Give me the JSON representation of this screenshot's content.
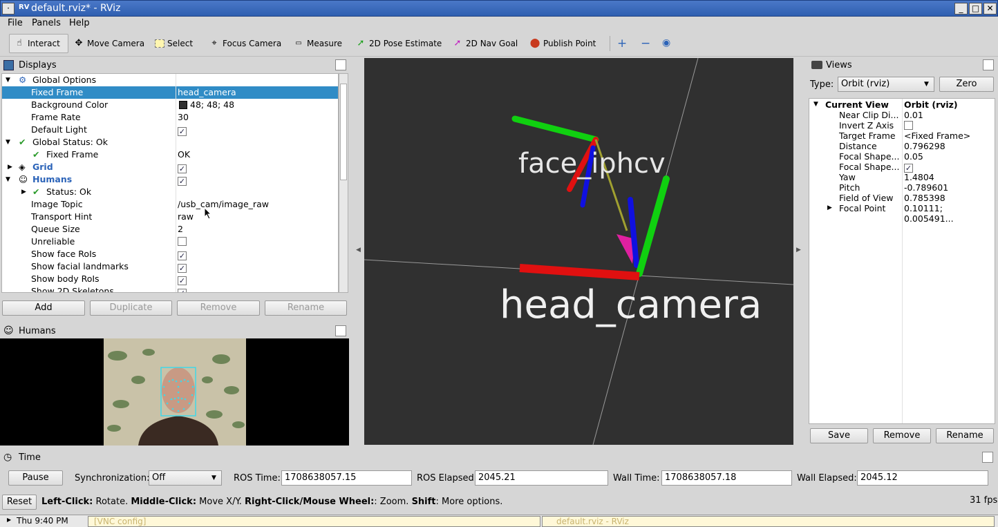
{
  "window": {
    "title": "default.rviz* - RViz",
    "app_icon": "rviz-icon"
  },
  "menu": [
    "File",
    "Panels",
    "Help"
  ],
  "toolbar": {
    "tools": [
      {
        "label": "Interact",
        "icon": "hand-icon",
        "active": true
      },
      {
        "label": "Move Camera",
        "icon": "move-icon"
      },
      {
        "label": "Select",
        "icon": "select-icon"
      },
      {
        "label": "Focus Camera",
        "icon": "crosshair-icon"
      },
      {
        "label": "Measure",
        "icon": "ruler-icon"
      },
      {
        "label": "2D Pose Estimate",
        "icon": "green-arrow-icon"
      },
      {
        "label": "2D Nav Goal",
        "icon": "magenta-arrow-icon"
      },
      {
        "label": "Publish Point",
        "icon": "pin-icon"
      }
    ]
  },
  "displays": {
    "title": "Displays",
    "rows": [
      {
        "key": "Global Options",
        "value": ""
      },
      {
        "key": "Fixed Frame",
        "value": "head_camera"
      },
      {
        "key": "Background Color",
        "value": "48; 48; 48"
      },
      {
        "key": "Frame Rate",
        "value": "30"
      },
      {
        "key": "Default Light",
        "value": ""
      },
      {
        "key": "Global Status: Ok",
        "value": ""
      },
      {
        "key": "Fixed Frame",
        "value": "OK"
      },
      {
        "key": "Grid",
        "value": ""
      },
      {
        "key": "Humans",
        "value": ""
      },
      {
        "key": "Status: Ok",
        "value": ""
      },
      {
        "key": "Image Topic",
        "value": "/usb_cam/image_raw"
      },
      {
        "key": "Transport Hint",
        "value": "raw"
      },
      {
        "key": "Queue Size",
        "value": "2"
      },
      {
        "key": "Unreliable",
        "value": ""
      },
      {
        "key": "Show face RoIs",
        "value": ""
      },
      {
        "key": "Show facial landmarks",
        "value": ""
      },
      {
        "key": "Show body RoIs",
        "value": ""
      },
      {
        "key": "Show 2D Skeletons",
        "value": ""
      }
    ],
    "buttons": {
      "add": "Add",
      "duplicate": "Duplicate",
      "remove": "Remove",
      "rename": "Rename"
    }
  },
  "humans_panel": {
    "title": "Humans"
  },
  "viewport": {
    "labels": {
      "face": "face_iphcv",
      "camera": "head_camera"
    }
  },
  "views": {
    "title": "Views",
    "type_label": "Type:",
    "type_value": "Orbit (rviz)",
    "zero_button": "Zero",
    "current_view": {
      "key": "Current View",
      "value": "Orbit (rviz)"
    },
    "rows": [
      {
        "key": "Near Clip Di...",
        "value": "0.01"
      },
      {
        "key": "Invert Z Axis",
        "value": ""
      },
      {
        "key": "Target Frame",
        "value": "<Fixed Frame>"
      },
      {
        "key": "Distance",
        "value": "0.796298"
      },
      {
        "key": "Focal Shape...",
        "value": "0.05"
      },
      {
        "key": "Focal Shape...",
        "value": ""
      },
      {
        "key": "Yaw",
        "value": "1.4804"
      },
      {
        "key": "Pitch",
        "value": "-0.789601"
      },
      {
        "key": "Field of View",
        "value": "0.785398"
      },
      {
        "key": "Focal Point",
        "value": "0.10111; 0.005491..."
      }
    ],
    "buttons": {
      "save": "Save",
      "remove": "Remove",
      "rename": "Rename"
    }
  },
  "time": {
    "title": "Time",
    "pause": "Pause",
    "sync_label": "Synchronization:",
    "sync_value": "Off",
    "ros_time_label": "ROS Time:",
    "ros_time": "1708638057.15",
    "ros_elapsed_label": "ROS Elapsed:",
    "ros_elapsed": "2045.21",
    "wall_time_label": "Wall Time:",
    "wall_time": "1708638057.18",
    "wall_elapsed_label": "Wall Elapsed:",
    "wall_elapsed": "2045.12"
  },
  "status": {
    "reset": "Reset",
    "hint_parts": [
      "Left-Click:",
      " Rotate. ",
      "Middle-Click:",
      " Move X/Y. ",
      "Right-Click/Mouse Wheel:",
      ": Zoom. ",
      "Shift",
      ": More options."
    ],
    "fps": "31 fps"
  },
  "taskbar": {
    "clock": "Thu  9:40 PM",
    "task1": "[VNC config]",
    "task2": "default.rviz - RViz"
  }
}
